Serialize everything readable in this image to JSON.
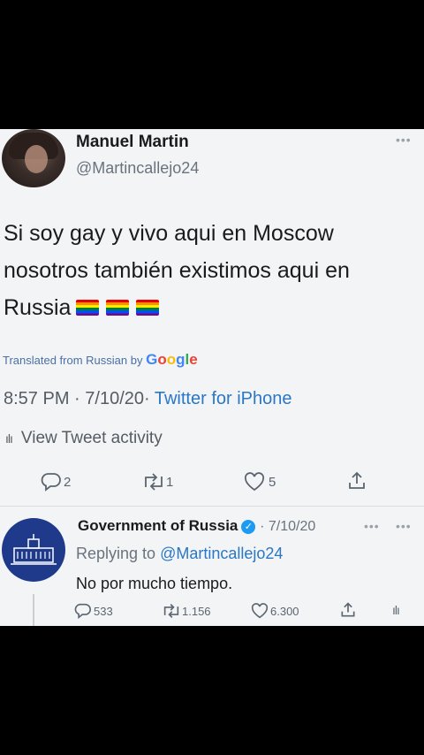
{
  "tweet": {
    "author_name": "Manuel Martin",
    "author_handle": "@Martincallejo24",
    "text_line1": "Si soy gay y vivo aqui en Moscow",
    "text_line2": "nosotros también existimos aqui en",
    "text_line3": "Russia",
    "translated_label": "Translated from Russian by",
    "translator_brand": "Google",
    "time": "8:57 PM",
    "date": "7/10/20",
    "client": "Twitter for iPhone",
    "activity_label": "View Tweet activity",
    "counts": {
      "replies": "2",
      "retweets": "1",
      "likes": "5"
    }
  },
  "reply": {
    "author_name": "Government of Russia",
    "date": "7/10/20",
    "replying_label": "Replying to",
    "replying_handle": "@Martincallejo24",
    "text": "No por mucho tiempo.",
    "counts": {
      "replies": "533",
      "retweets": "1.156",
      "likes": "6.300"
    }
  },
  "icons": {
    "flag": "rainbow-flag-icon",
    "reply": "reply-icon",
    "retweet": "retweet-icon",
    "like": "heart-icon",
    "share": "share-icon",
    "activity": "activity-bars-icon",
    "more": "more-dots-icon",
    "verified": "verified-badge-icon"
  },
  "colors": {
    "background": "#000000",
    "card": "#f3f4f6",
    "link": "#2a77c4",
    "muted": "#6a737d",
    "verified": "#1d9bf0",
    "gov_avatar": "#1f3a8a"
  }
}
